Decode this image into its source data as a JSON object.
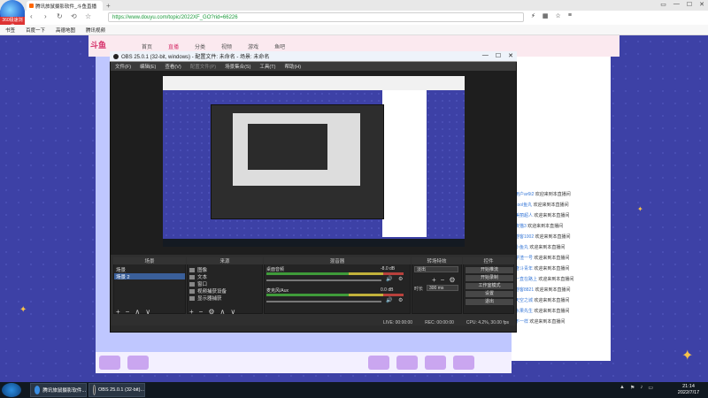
{
  "browser": {
    "logo_label": "360极速浏览",
    "tab_title": "腾讯旅鼠摄影软件_斗鱼直播",
    "tab_add": "+",
    "url": "https://www.douyu.com/topic/2022XF_GO?rid=66226",
    "win_controls": [
      "▭",
      "—",
      "☐",
      "✕"
    ],
    "nav": [
      "‹",
      "›",
      "↻",
      "⟲",
      "☆"
    ],
    "bookmarks": [
      "书签",
      "百度一下",
      "高德地图",
      "腾讯视频"
    ]
  },
  "site": {
    "logo": "斗鱼",
    "nav": [
      "首页",
      "直播",
      "分类",
      "视频",
      "游戏",
      "鱼吧"
    ],
    "chat": [
      {
        "name": "用户ar6t2",
        "msg": "欢迎来到本直播间"
      },
      {
        "name": "cool鱼丸",
        "msg": "欢迎来到本直播间"
      },
      {
        "name": "美丽超人",
        "msg": "欢迎来到本直播间"
      },
      {
        "name": "夜猫3",
        "msg": "欢迎来到本直播间"
      },
      {
        "name": "游客1002",
        "msg": "欢迎来到本直播间"
      },
      {
        "name": "小鱼丸",
        "msg": "欢迎来到本直播间"
      },
      {
        "name": "学渣一号",
        "msg": "欢迎来到本直播间"
      },
      {
        "name": "奋斗青年",
        "msg": "欢迎来到本直播间"
      },
      {
        "name": "一直在路上",
        "msg": "欢迎来到本直播间"
      },
      {
        "name": "游客8821",
        "msg": "欢迎来到本直播间"
      },
      {
        "name": "天空之城",
        "msg": "欢迎来到本直播间"
      },
      {
        "name": "水果先生",
        "msg": "欢迎来到本直播间"
      },
      {
        "name": "不一样",
        "msg": "欢迎来到本直播间"
      }
    ]
  },
  "obs": {
    "title": "OBS 25.0.1 (32-bit, windows) - 配置文件: 未命名 - 场景: 未命名",
    "menu": [
      "文件(F)",
      "编辑(E)",
      "查看(V)",
      "配置文件(P)",
      "场景集合(S)",
      "工具(T)",
      "帮助(H)"
    ],
    "docks": {
      "scenes": "场景",
      "sources": "来源",
      "mixer": "混音器",
      "transitions": "转场特效",
      "controls": "控件"
    },
    "scene_items": [
      "场景",
      "场景 2"
    ],
    "source_items": [
      "图像",
      "文本",
      "窗口",
      "视频捕获设备",
      "显示器捕获"
    ],
    "mixer_items": [
      {
        "label": "桌面音频",
        "db": "-8.0 dB"
      },
      {
        "label": "麦克风/Aux",
        "db": "0.0 dB"
      }
    ],
    "transition": {
      "name": "淡出",
      "duration_label": "时长",
      "duration": "300 ms"
    },
    "controls": [
      "开始推流",
      "开始录制",
      "工作室模式",
      "设置",
      "退出"
    ],
    "status": {
      "live": "LIVE: 00:00:00",
      "rec": "REC: 00:00:00",
      "cpu": "CPU: 4.2%, 30.00 fps"
    }
  },
  "taskbar": {
    "items": [
      "腾讯旅鼠摄影软件...",
      "OBS 25.0.1 (32-bit)..."
    ],
    "time": "21:14",
    "date": "2022/7/17"
  }
}
